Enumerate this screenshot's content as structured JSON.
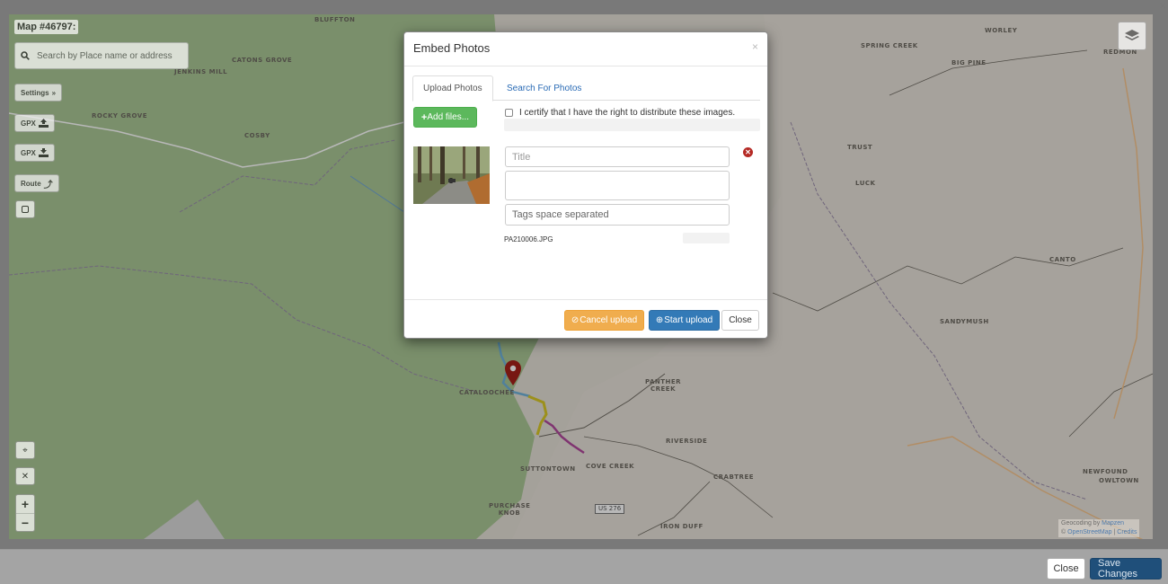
{
  "map": {
    "title": "Map #46797:",
    "search_placeholder": "Search by Place name or address",
    "controls": {
      "settings": "Settings",
      "gpx_upload": "GPX",
      "gpx_download": "GPX",
      "route": "Route",
      "zoom_in": "+",
      "zoom_out": "−"
    },
    "places": [
      "BLUFFTON",
      "CATONS GROVE",
      "JENKINS MILL",
      "ROCKY GROVE",
      "COSBY",
      "WORLEY",
      "SPRING CREEK",
      "BIG PINE",
      "REDMON",
      "TRUST",
      "LUCK",
      "CANTO",
      "SANDYMUSH",
      "CATALOOCHEE",
      "PANTHER CREEK",
      "RIVERSIDE",
      "SUTTONTOWN",
      "COVE CREEK",
      "CRABTREE",
      "NEWFOUND",
      "OWLTOWN",
      "PURCHASE KNOB",
      "IRON DUFF"
    ],
    "route_shield": "US 276",
    "attribution": {
      "line1_prefix": "Geocoding by",
      "line1_link": "Mapzen",
      "line2_prefix": "©",
      "line2_link1": "OpenStreetMap",
      "separator": "|",
      "line2_link2": "Credits"
    }
  },
  "modal": {
    "title": "Embed Photos",
    "close_glyph": "×",
    "tabs": [
      "Upload Photos",
      "Search For Photos"
    ],
    "add_files_label": "Add files...",
    "certify_label": "I certify that I have the right to distribute these images.",
    "upload_item": {
      "title_placeholder": "Title",
      "tags_placeholder": "Tags space separated",
      "file_name": "PA210006.JPG"
    },
    "buttons": {
      "cancel_upload": "Cancel upload",
      "start_upload": "Start upload",
      "close": "Close"
    }
  },
  "footer": {
    "close": "Close",
    "save_changes": "Save Changes"
  },
  "colors": {
    "add_files": "#5cb85c",
    "cancel_upload": "#f0ad4e",
    "start_upload": "#337ab7",
    "save_changes": "#1f4f7a",
    "marker": "#a6201a"
  },
  "icons": [
    "search-icon",
    "layers-icon",
    "upload-icon",
    "download-icon",
    "route-icon",
    "square-draw-icon",
    "locate-icon",
    "fullscreen-icon",
    "plus-icon",
    "ban-icon",
    "upload-circle-icon",
    "remove-icon",
    "map-marker-icon"
  ]
}
